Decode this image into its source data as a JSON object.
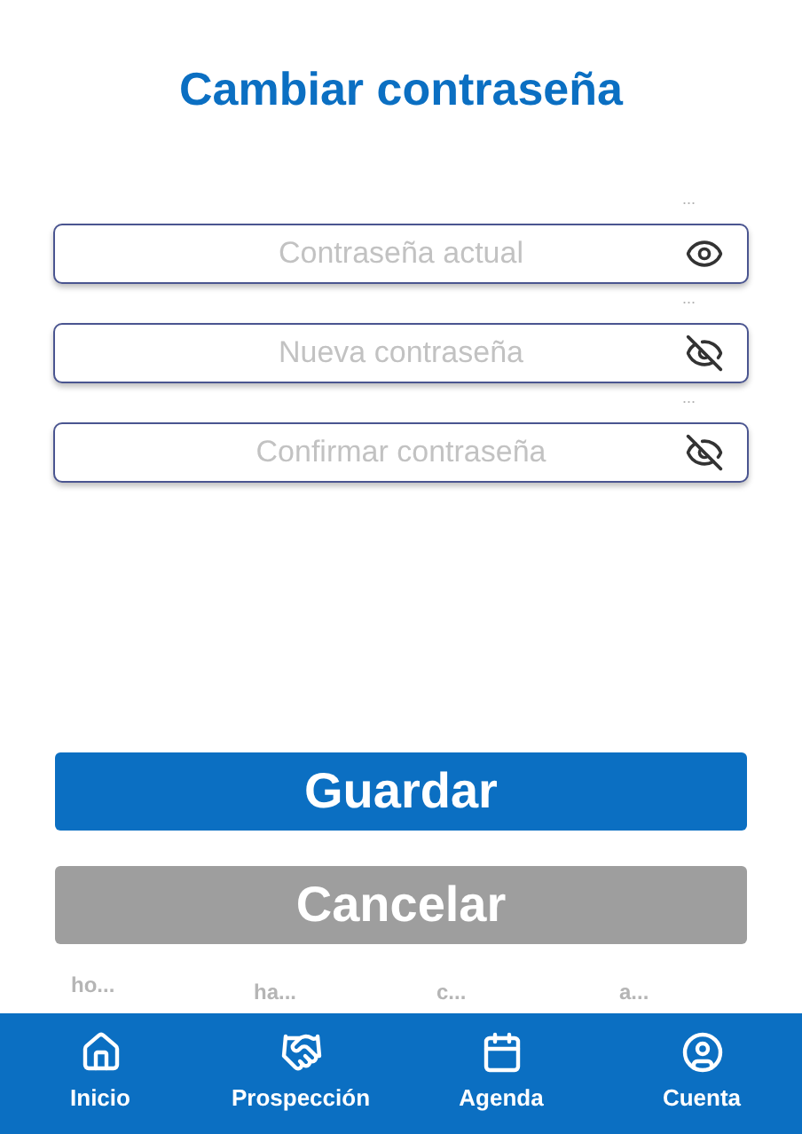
{
  "title": "Cambiar contraseña",
  "fields": [
    {
      "hint": "...",
      "placeholder": "Contraseña actual",
      "visible": true
    },
    {
      "hint": "...",
      "placeholder": "Nueva contraseña",
      "visible": false
    },
    {
      "hint": "...",
      "placeholder": "Confirmar contraseña",
      "visible": false
    }
  ],
  "buttons": [
    {
      "label": "Guardar",
      "kind": "primary"
    },
    {
      "label": "Cancelar",
      "kind": "secondary"
    }
  ],
  "nav_hints": [
    "ho...",
    "ha...",
    "c...",
    "a..."
  ],
  "nav": [
    {
      "label": "Inicio"
    },
    {
      "label": "Prospección"
    },
    {
      "label": "Agenda"
    },
    {
      "label": "Cuenta"
    }
  ]
}
